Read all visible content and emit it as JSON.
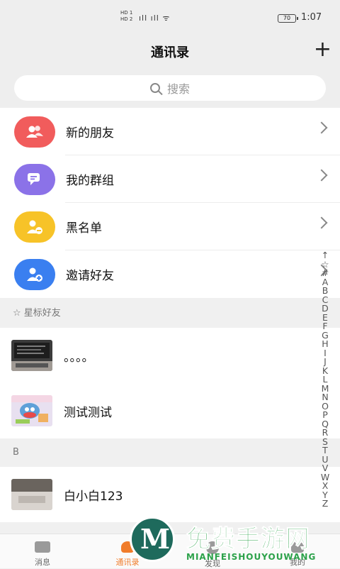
{
  "status_bar": {
    "sim1": "HD 1",
    "sim2": "HD 2",
    "battery": "70",
    "time": "1:07"
  },
  "header": {
    "title": "通讯录",
    "add_icon": "plus-icon"
  },
  "search": {
    "placeholder": "搜索"
  },
  "menu": [
    {
      "label": "新的朋友",
      "icon": "people-icon",
      "color": "#f15c5c"
    },
    {
      "label": "我的群组",
      "icon": "chat-bubble-icon",
      "color": "#8b72e8"
    },
    {
      "label": "黑名单",
      "icon": "person-minus-icon",
      "color": "#f7c328"
    },
    {
      "label": "邀请好友",
      "icon": "person-plus-icon",
      "color": "#3a7ff0"
    }
  ],
  "starred_section": {
    "label": "☆ 星标好友"
  },
  "starred": [
    {
      "name": "。。。。"
    },
    {
      "name": "测试测试"
    }
  ],
  "section_b": {
    "label": "B"
  },
  "contacts_b": [
    {
      "name": "白小白123"
    }
  ],
  "index": [
    "↑",
    "☆",
    "#",
    "A",
    "B",
    "C",
    "D",
    "E",
    "F",
    "G",
    "H",
    "I",
    "J",
    "K",
    "L",
    "M",
    "N",
    "O",
    "P",
    "Q",
    "R",
    "S",
    "T",
    "U",
    "V",
    "W",
    "X",
    "Y",
    "Z"
  ],
  "tabs": [
    {
      "label": "消息",
      "icon": "message-icon",
      "active": false
    },
    {
      "label": "通讯录",
      "icon": "contacts-icon",
      "active": true
    },
    {
      "label": "发现",
      "icon": "discover-icon",
      "active": false
    },
    {
      "label": "我的",
      "icon": "profile-icon",
      "active": false
    }
  ],
  "watermark": {
    "text": "免费手游网",
    "subtext": "MIANFEISHOUYOUWANG"
  },
  "colors": {
    "accent": "#f07c2a",
    "background": "#f0f0f0"
  }
}
